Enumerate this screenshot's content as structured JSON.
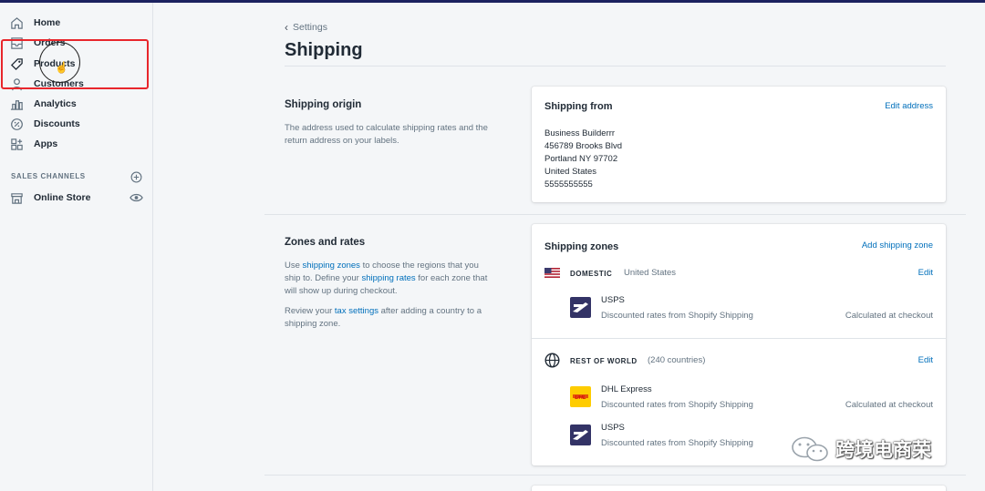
{
  "sidebar": {
    "items": [
      {
        "label": "Home",
        "icon": "home-icon"
      },
      {
        "label": "Orders",
        "icon": "orders-icon"
      },
      {
        "label": "Products",
        "icon": "tag-icon"
      },
      {
        "label": "Customers",
        "icon": "customer-icon"
      },
      {
        "label": "Analytics",
        "icon": "bar-chart-icon"
      },
      {
        "label": "Discounts",
        "icon": "discount-icon"
      },
      {
        "label": "Apps",
        "icon": "apps-icon"
      }
    ],
    "sales_channels_title": "SALES CHANNELS",
    "online_store_label": "Online Store"
  },
  "header": {
    "breadcrumb": "Settings",
    "title": "Shipping"
  },
  "origin": {
    "title": "Shipping origin",
    "description": "The address used to calculate shipping rates and the return address on your labels.",
    "card_title": "Shipping from",
    "edit_label": "Edit address",
    "address": [
      "Business Builderrr",
      "456789 Brooks Blvd",
      "Portland NY 97702",
      "United States",
      "5555555555"
    ]
  },
  "zones": {
    "title": "Zones and rates",
    "desc1_a": "Use ",
    "desc1_link1": "shipping zones",
    "desc1_b": " to choose the regions that you ship to. Define your ",
    "desc1_link2": "shipping rates",
    "desc1_c": " for each zone that will show up during checkout.",
    "desc2_a": "Review your ",
    "desc2_link": "tax settings",
    "desc2_b": " after adding a country to a shipping zone.",
    "card_title": "Shipping zones",
    "add_label": "Add shipping zone",
    "domestic": {
      "name": "DOMESTIC",
      "region": "United States",
      "edit": "Edit",
      "carriers": [
        {
          "name": "USPS",
          "desc": "Discounted rates from Shopify Shipping",
          "rate": "Calculated at checkout"
        }
      ]
    },
    "world": {
      "name": "REST OF WORLD",
      "region": "(240 countries)",
      "edit": "Edit",
      "carriers": [
        {
          "name": "DHL Express",
          "desc": "Discounted rates from Shopify Shipping",
          "rate": "Calculated at checkout"
        },
        {
          "name": "USPS",
          "desc": "Discounted rates from Shopify Shipping",
          "rate": ""
        }
      ]
    }
  },
  "watermark": "跨境电商荣",
  "colors": {
    "accent": "#006fbb",
    "highlight": "#e8262c",
    "dhl_yellow": "#fecc00",
    "usps_blue": "#333366"
  }
}
